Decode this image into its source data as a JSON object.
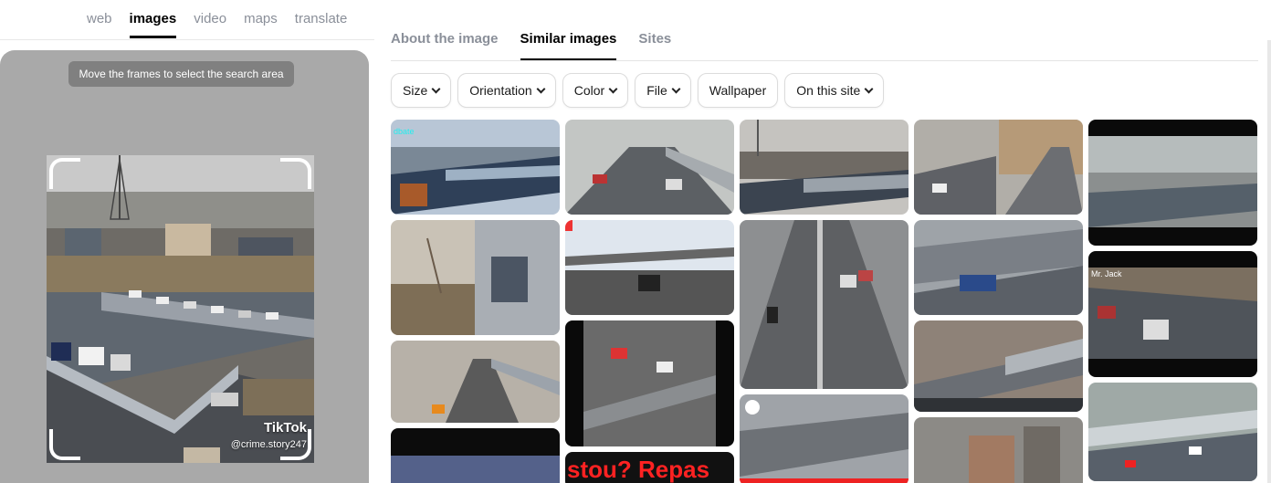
{
  "nav": {
    "tabs": [
      {
        "label": "web"
      },
      {
        "label": "images"
      },
      {
        "label": "video"
      },
      {
        "label": "maps"
      },
      {
        "label": "translate"
      }
    ],
    "active": "images"
  },
  "panel": {
    "hint": "Move the frames to select the search area",
    "watermark": "TikTok",
    "watermark_handle": "@crime.story247"
  },
  "results": {
    "tabs": [
      {
        "label": "About the image"
      },
      {
        "label": "Similar images"
      },
      {
        "label": "Sites"
      }
    ],
    "active": "Similar images",
    "filters": [
      {
        "label": "Size"
      },
      {
        "label": "Orientation"
      },
      {
        "label": "Color"
      },
      {
        "label": "File"
      },
      {
        "label": "Wallpaper"
      },
      {
        "label": "On this site"
      }
    ],
    "thumb_labels": {
      "dbate": "dbate",
      "mr_jack": "Mr. Jack",
      "repas": "stou? Repas"
    }
  },
  "colors": {
    "accent": "#000000",
    "panel_bg": "#a9a9a9",
    "hint_bg": "#808080"
  }
}
